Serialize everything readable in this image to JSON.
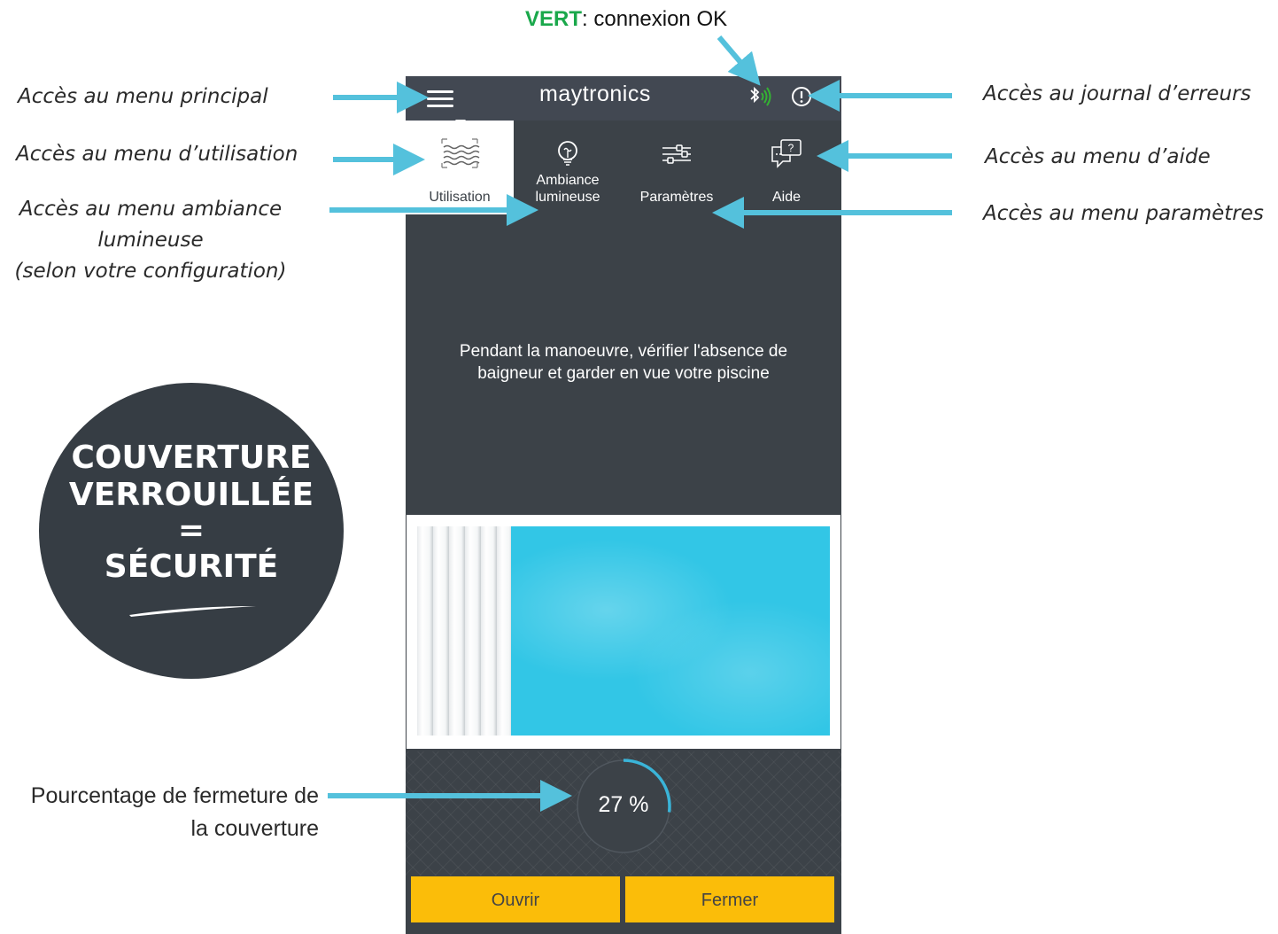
{
  "top_note": {
    "highlight": "VERT",
    "text": ": connexion OK"
  },
  "annotations": {
    "main_menu": "Accès au menu principal",
    "usage_menu": "Accès au menu d’utilisation",
    "ambiance_menu_line1": "Accès au menu ambiance",
    "ambiance_menu_line2": "lumineuse",
    "ambiance_menu_line3": "(selon votre configuration)",
    "error_log": "Accès au journal d’erreurs",
    "help_menu": "Accès au menu d’aide",
    "settings_menu": "Accès au menu paramètres",
    "percentage_line1": "Pourcentage de fermeture de",
    "percentage_line2": "la couverture"
  },
  "badge": {
    "line1": "COUVERTURE",
    "line2": "VERROUILLÉE",
    "line3": "=",
    "line4": "SÉCURITÉ"
  },
  "app": {
    "logo": "maytronics",
    "tabs": [
      {
        "label": "Utilisation",
        "icon": "waves-icon",
        "active": true
      },
      {
        "label": "Ambiance lumineuse",
        "label_line1": "Ambiance",
        "label_line2": "lumineuse",
        "icon": "bulb-icon",
        "active": false
      },
      {
        "label": "Paramètres",
        "icon": "sliders-icon",
        "active": false
      },
      {
        "label": "Aide",
        "icon": "help-chat-icon",
        "active": false
      }
    ],
    "message_line1": "Pendant la manoeuvre, vérifier l'absence de",
    "message_line2": "baigneur et garder en vue votre piscine",
    "closure_percent": 27,
    "closure_text": "27 %",
    "buttons": {
      "open": "Ouvrir",
      "close": "Fermer"
    },
    "colors": {
      "background": "#3c4248",
      "topbar": "#424852",
      "accent_button": "#fbbd09",
      "water": "#32c6e6",
      "gauge": "#3ab4d8",
      "bluetooth_ok": "#34b233",
      "arrow": "#54c1dc"
    }
  }
}
